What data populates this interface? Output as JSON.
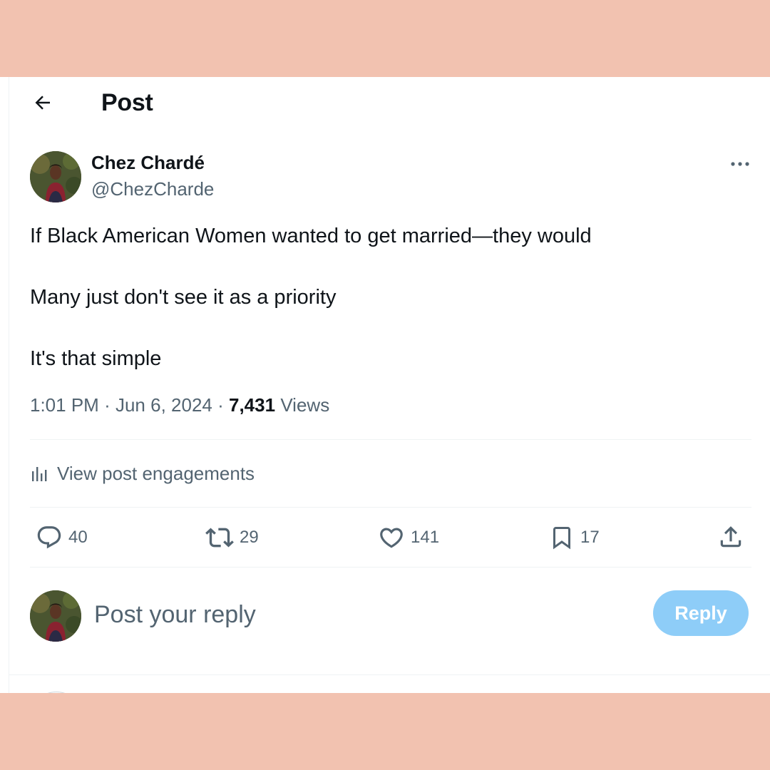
{
  "header": {
    "back_icon": "arrow-left-icon",
    "title": "Post"
  },
  "post": {
    "author": {
      "name": "Chez Chardé",
      "handle": "@ChezCharde"
    },
    "text_lines": [
      "If Black American Women wanted to get married—they would",
      "Many just don't see it as a priority",
      "It's that simple"
    ],
    "meta": {
      "time": "1:01 PM",
      "separator": "·",
      "date": "Jun 6, 2024",
      "views_count": "7,431",
      "views_label": "Views"
    },
    "engagements_label": "View post engagements",
    "actions": {
      "replies": "40",
      "reposts": "29",
      "likes": "141",
      "bookmarks": "17"
    }
  },
  "reply_box": {
    "placeholder": "Post your reply",
    "button_label": "Reply"
  },
  "colors": {
    "background_band": "#f2c2b0",
    "secondary_text": "#536471",
    "primary_text": "#0f1419",
    "reply_button": "#8ecdf8"
  }
}
